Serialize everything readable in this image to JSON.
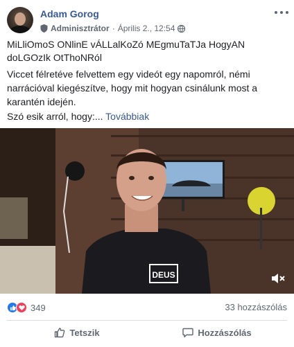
{
  "post": {
    "author": "Adam Gorog",
    "role": "Adminisztrátor",
    "separator": "·",
    "date": "Április 2., 12:54",
    "title": "MiLliOmoS ONlinE vÁLLalKoZó MEgmuTaTJa HogyAN doLGOzIk OtThoNRól",
    "body": "Viccet félretéve felvettem egy videót egy napomról, némi narrációval kiegészítve, hogy mit hogyan csinálunk most a karantén idején.",
    "body_short": "Szó esik arról, hogy:...",
    "more_link": "Továbbiak"
  },
  "video": {
    "shirt_text": "DEUS"
  },
  "stats": {
    "reaction_count": "349",
    "comment_count": "33 hozzászólás"
  },
  "actions": {
    "like_label": "Tetszik",
    "comment_label": "Hozzászólás"
  },
  "icons": {
    "avatar": "profile-photo",
    "role": "shield-icon",
    "privacy": "globe-icon",
    "menu": "more-dots-icon",
    "mute": "mute-speaker-icon",
    "like": "thumbs-up-icon",
    "comment": "comment-bubble-icon"
  },
  "colors": {
    "link": "#385898",
    "like_reaction": "#2078f4",
    "love_reaction": "#f33e58",
    "secondary_text": "#606770"
  }
}
